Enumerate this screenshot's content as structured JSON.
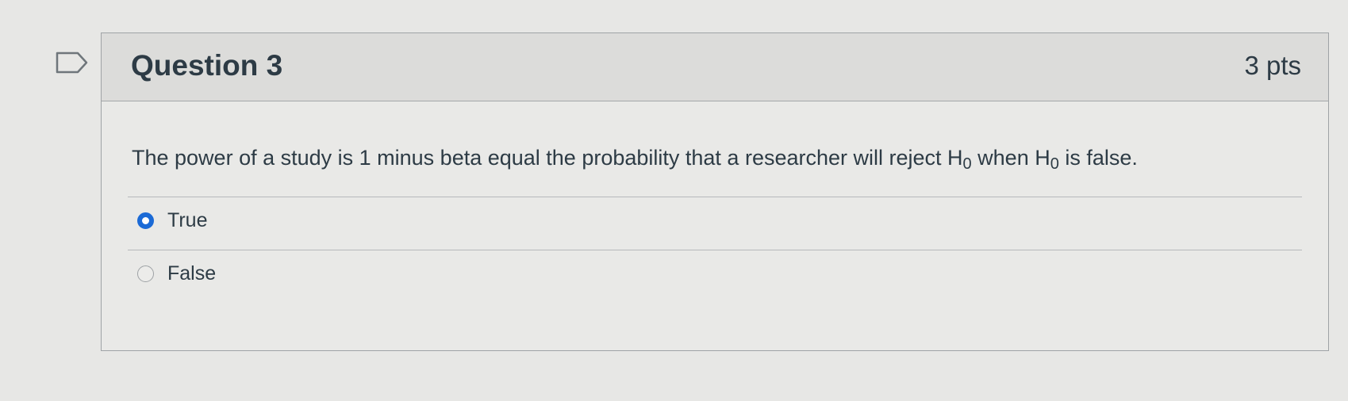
{
  "question": {
    "title": "Question 3",
    "points": "3 pts",
    "text_before": "The power of a study is 1 minus beta equal the probability that a researcher will reject H",
    "sub_1": "0",
    "text_middle": " when H",
    "sub_2": "0",
    "text_after": " is false.",
    "flag_icon": "flag-bookmark-icon"
  },
  "answers": [
    {
      "label": "True",
      "selected": true
    },
    {
      "label": "False",
      "selected": false
    }
  ],
  "colors": {
    "accent": "#1b6ad6",
    "text": "#2d3b45",
    "background": "#e7e7e5",
    "header": "#dcdcda"
  }
}
